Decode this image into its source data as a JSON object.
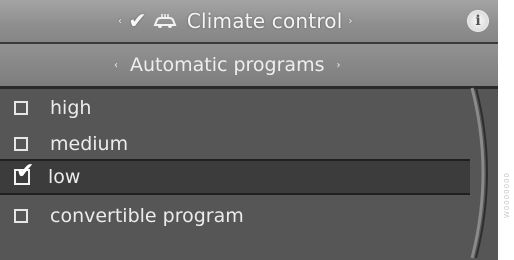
{
  "header": {
    "title": "Climate control",
    "left_arrow": "‹",
    "right_arrow": "›",
    "check": "✔",
    "info": "i"
  },
  "section": {
    "title": "Automatic programs",
    "left_arrow": "‹",
    "right_arrow": "›"
  },
  "programs": {
    "items": [
      {
        "label": "high",
        "checked": false
      },
      {
        "label": "medium",
        "checked": false
      },
      {
        "label": "low",
        "checked": true
      },
      {
        "label": "convertible program",
        "checked": false
      }
    ]
  },
  "watermark": "W0000000",
  "colors": {
    "screen_bg": "#565656",
    "selected_row": "#3c3c3c",
    "text": "#ececec"
  }
}
